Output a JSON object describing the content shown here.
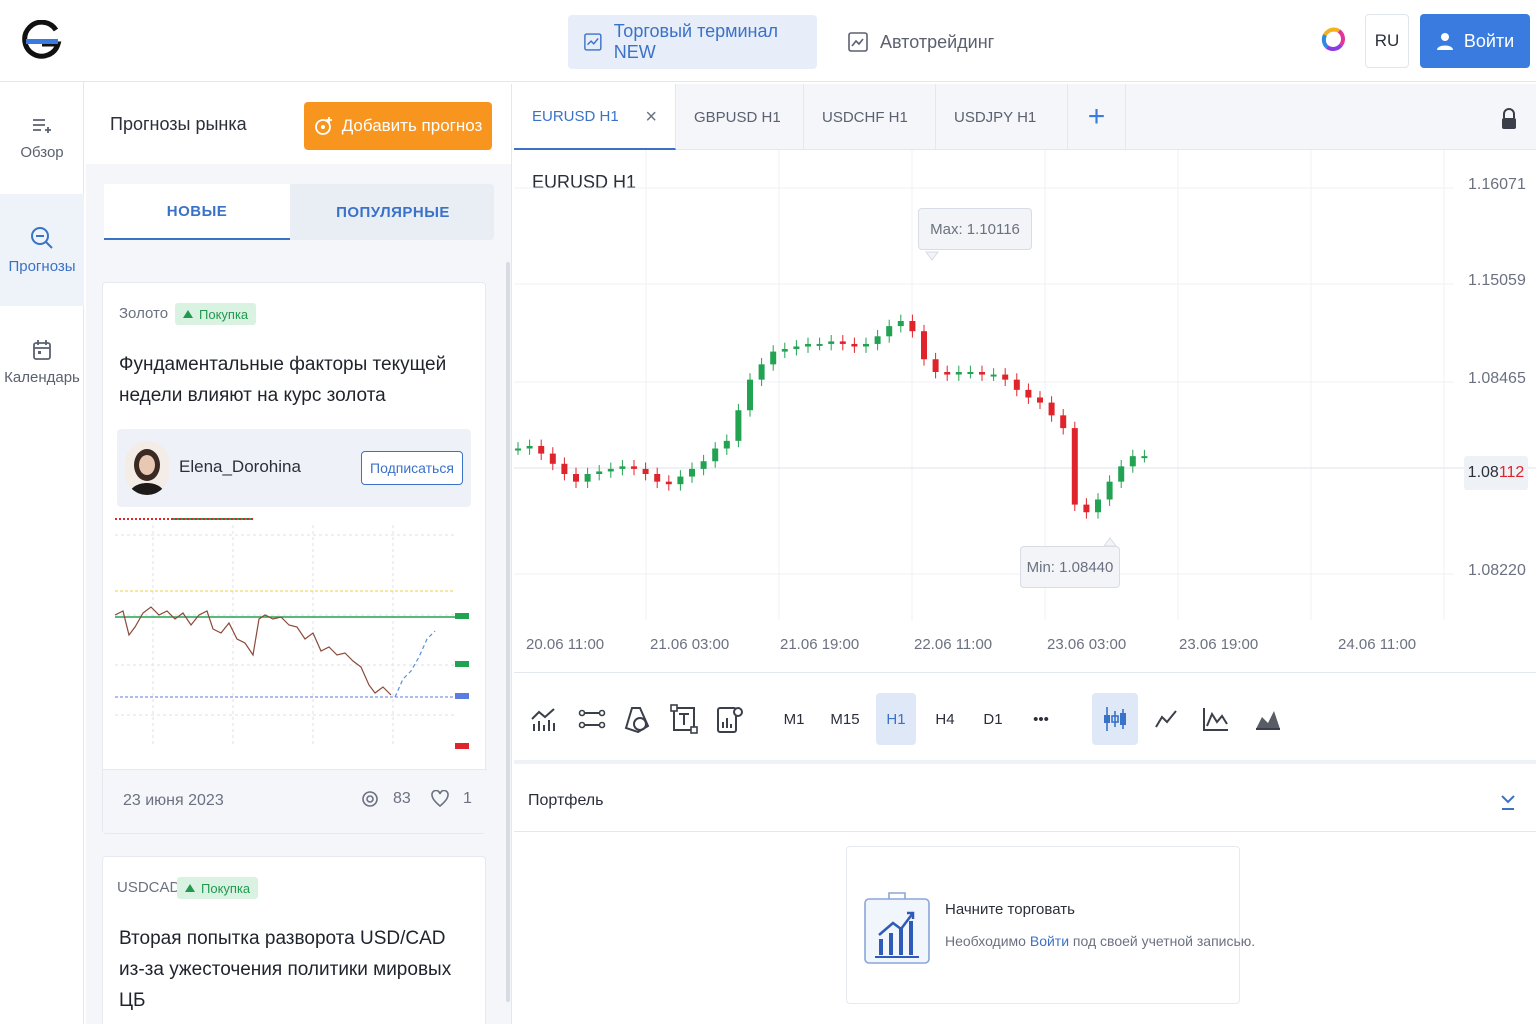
{
  "header": {
    "nav": [
      {
        "label": "Торговый терминал NEW",
        "active": true
      },
      {
        "label": "Автотрейдинг",
        "active": false
      }
    ],
    "lang": "RU",
    "login": "Войти"
  },
  "rail": [
    {
      "label": "Обзор",
      "icon": "list-add-icon"
    },
    {
      "label": "Прогнозы",
      "icon": "search-icon",
      "active": true
    },
    {
      "label": "Календарь",
      "icon": "calendar-icon"
    }
  ],
  "forecasts": {
    "title": "Прогнозы рынка",
    "add_label": "Добавить прогноз",
    "tabs": [
      "НОВЫЕ",
      "ПОПУЛЯРНЫЕ"
    ],
    "cards": [
      {
        "asset": "Золото",
        "direction": "Покупка",
        "title": "Фундаментальные факторы текущей недели влияют на курс золота",
        "author": "Elena_Dorohina",
        "subscribe": "Подписаться",
        "date": "23 июня 2023",
        "views": "83",
        "likes": "1"
      },
      {
        "asset": "USDCAD",
        "direction": "Покупка",
        "title": "Вторая попытка разворота USD/CAD из-за ужесточения политики мировых ЦБ"
      }
    ]
  },
  "chart_tabs": [
    "EURUSD H1",
    "GBPUSD H1",
    "USDCHF H1",
    "USDJPY H1"
  ],
  "chart": {
    "title": "EURUSD  H1",
    "max_label": "Max: 1.10116",
    "min_label": "Min: 1.08440",
    "current_price_head": "1.08",
    "current_price_tail": "112",
    "colors": {
      "up": "#22a352",
      "down": "#e0242c",
      "accent": "#3a7be0"
    }
  },
  "chart_data": {
    "type": "candlestick",
    "title": "EURUSD  H1",
    "y_ticks": [
      "1.16071",
      "1.15059",
      "1.08465",
      "1.08220"
    ],
    "x_ticks": [
      "20.06 11:00",
      "21.06 03:00",
      "21.06 19:00",
      "22.06 11:00",
      "23.06 03:00",
      "23.06 19:00",
      "24.06 11:00"
    ],
    "close_series": [
      0.3,
      0.31,
      0.28,
      0.24,
      0.2,
      0.17,
      0.2,
      0.21,
      0.22,
      0.23,
      0.22,
      0.2,
      0.17,
      0.16,
      0.19,
      0.22,
      0.25,
      0.3,
      0.33,
      0.45,
      0.57,
      0.63,
      0.68,
      0.69,
      0.7,
      0.71,
      0.71,
      0.72,
      0.71,
      0.7,
      0.71,
      0.74,
      0.78,
      0.8,
      0.76,
      0.65,
      0.6,
      0.59,
      0.6,
      0.6,
      0.59,
      0.59,
      0.57,
      0.53,
      0.5,
      0.48,
      0.43,
      0.38,
      0.08,
      0.05,
      0.1,
      0.17,
      0.23,
      0.27,
      0.27
    ],
    "max": 1.10116,
    "min": 1.0844,
    "current": 1.08112,
    "grid": true
  },
  "toolbar": {
    "timeframes": [
      "M1",
      "M15",
      "H1",
      "H4",
      "D1",
      "•••"
    ],
    "active_timeframe": "H1"
  },
  "portfolio": {
    "title": "Портфель",
    "empty_title": "Начните торговать",
    "empty_text_pre": "Необходимо ",
    "empty_link": "Войти",
    "empty_text_post": " под своей учетной записью."
  }
}
